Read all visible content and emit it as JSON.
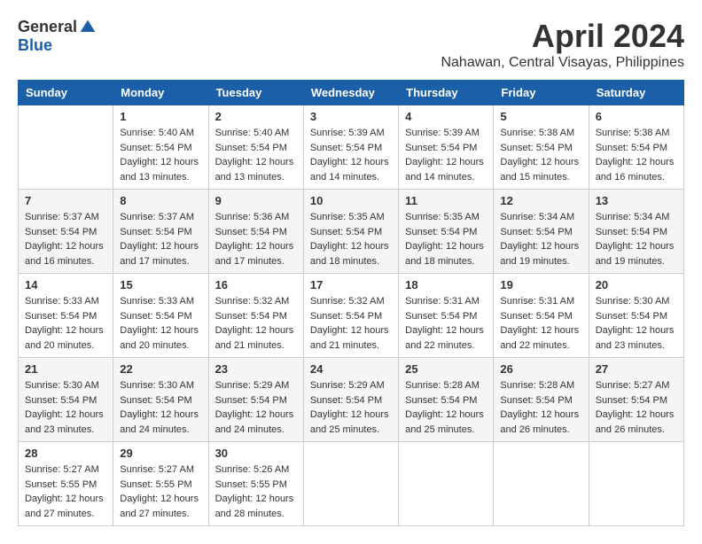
{
  "logo": {
    "general": "General",
    "blue": "Blue"
  },
  "title": {
    "month": "April 2024",
    "location": "Nahawan, Central Visayas, Philippines"
  },
  "headers": [
    "Sunday",
    "Monday",
    "Tuesday",
    "Wednesday",
    "Thursday",
    "Friday",
    "Saturday"
  ],
  "weeks": [
    [
      {
        "day": "",
        "sunrise": "",
        "sunset": "",
        "daylight": ""
      },
      {
        "day": "1",
        "sunrise": "Sunrise: 5:40 AM",
        "sunset": "Sunset: 5:54 PM",
        "daylight": "Daylight: 12 hours and 13 minutes."
      },
      {
        "day": "2",
        "sunrise": "Sunrise: 5:40 AM",
        "sunset": "Sunset: 5:54 PM",
        "daylight": "Daylight: 12 hours and 13 minutes."
      },
      {
        "day": "3",
        "sunrise": "Sunrise: 5:39 AM",
        "sunset": "Sunset: 5:54 PM",
        "daylight": "Daylight: 12 hours and 14 minutes."
      },
      {
        "day": "4",
        "sunrise": "Sunrise: 5:39 AM",
        "sunset": "Sunset: 5:54 PM",
        "daylight": "Daylight: 12 hours and 14 minutes."
      },
      {
        "day": "5",
        "sunrise": "Sunrise: 5:38 AM",
        "sunset": "Sunset: 5:54 PM",
        "daylight": "Daylight: 12 hours and 15 minutes."
      },
      {
        "day": "6",
        "sunrise": "Sunrise: 5:38 AM",
        "sunset": "Sunset: 5:54 PM",
        "daylight": "Daylight: 12 hours and 16 minutes."
      }
    ],
    [
      {
        "day": "7",
        "sunrise": "Sunrise: 5:37 AM",
        "sunset": "Sunset: 5:54 PM",
        "daylight": "Daylight: 12 hours and 16 minutes."
      },
      {
        "day": "8",
        "sunrise": "Sunrise: 5:37 AM",
        "sunset": "Sunset: 5:54 PM",
        "daylight": "Daylight: 12 hours and 17 minutes."
      },
      {
        "day": "9",
        "sunrise": "Sunrise: 5:36 AM",
        "sunset": "Sunset: 5:54 PM",
        "daylight": "Daylight: 12 hours and 17 minutes."
      },
      {
        "day": "10",
        "sunrise": "Sunrise: 5:35 AM",
        "sunset": "Sunset: 5:54 PM",
        "daylight": "Daylight: 12 hours and 18 minutes."
      },
      {
        "day": "11",
        "sunrise": "Sunrise: 5:35 AM",
        "sunset": "Sunset: 5:54 PM",
        "daylight": "Daylight: 12 hours and 18 minutes."
      },
      {
        "day": "12",
        "sunrise": "Sunrise: 5:34 AM",
        "sunset": "Sunset: 5:54 PM",
        "daylight": "Daylight: 12 hours and 19 minutes."
      },
      {
        "day": "13",
        "sunrise": "Sunrise: 5:34 AM",
        "sunset": "Sunset: 5:54 PM",
        "daylight": "Daylight: 12 hours and 19 minutes."
      }
    ],
    [
      {
        "day": "14",
        "sunrise": "Sunrise: 5:33 AM",
        "sunset": "Sunset: 5:54 PM",
        "daylight": "Daylight: 12 hours and 20 minutes."
      },
      {
        "day": "15",
        "sunrise": "Sunrise: 5:33 AM",
        "sunset": "Sunset: 5:54 PM",
        "daylight": "Daylight: 12 hours and 20 minutes."
      },
      {
        "day": "16",
        "sunrise": "Sunrise: 5:32 AM",
        "sunset": "Sunset: 5:54 PM",
        "daylight": "Daylight: 12 hours and 21 minutes."
      },
      {
        "day": "17",
        "sunrise": "Sunrise: 5:32 AM",
        "sunset": "Sunset: 5:54 PM",
        "daylight": "Daylight: 12 hours and 21 minutes."
      },
      {
        "day": "18",
        "sunrise": "Sunrise: 5:31 AM",
        "sunset": "Sunset: 5:54 PM",
        "daylight": "Daylight: 12 hours and 22 minutes."
      },
      {
        "day": "19",
        "sunrise": "Sunrise: 5:31 AM",
        "sunset": "Sunset: 5:54 PM",
        "daylight": "Daylight: 12 hours and 22 minutes."
      },
      {
        "day": "20",
        "sunrise": "Sunrise: 5:30 AM",
        "sunset": "Sunset: 5:54 PM",
        "daylight": "Daylight: 12 hours and 23 minutes."
      }
    ],
    [
      {
        "day": "21",
        "sunrise": "Sunrise: 5:30 AM",
        "sunset": "Sunset: 5:54 PM",
        "daylight": "Daylight: 12 hours and 23 minutes."
      },
      {
        "day": "22",
        "sunrise": "Sunrise: 5:30 AM",
        "sunset": "Sunset: 5:54 PM",
        "daylight": "Daylight: 12 hours and 24 minutes."
      },
      {
        "day": "23",
        "sunrise": "Sunrise: 5:29 AM",
        "sunset": "Sunset: 5:54 PM",
        "daylight": "Daylight: 12 hours and 24 minutes."
      },
      {
        "day": "24",
        "sunrise": "Sunrise: 5:29 AM",
        "sunset": "Sunset: 5:54 PM",
        "daylight": "Daylight: 12 hours and 25 minutes."
      },
      {
        "day": "25",
        "sunrise": "Sunrise: 5:28 AM",
        "sunset": "Sunset: 5:54 PM",
        "daylight": "Daylight: 12 hours and 25 minutes."
      },
      {
        "day": "26",
        "sunrise": "Sunrise: 5:28 AM",
        "sunset": "Sunset: 5:54 PM",
        "daylight": "Daylight: 12 hours and 26 minutes."
      },
      {
        "day": "27",
        "sunrise": "Sunrise: 5:27 AM",
        "sunset": "Sunset: 5:54 PM",
        "daylight": "Daylight: 12 hours and 26 minutes."
      }
    ],
    [
      {
        "day": "28",
        "sunrise": "Sunrise: 5:27 AM",
        "sunset": "Sunset: 5:55 PM",
        "daylight": "Daylight: 12 hours and 27 minutes."
      },
      {
        "day": "29",
        "sunrise": "Sunrise: 5:27 AM",
        "sunset": "Sunset: 5:55 PM",
        "daylight": "Daylight: 12 hours and 27 minutes."
      },
      {
        "day": "30",
        "sunrise": "Sunrise: 5:26 AM",
        "sunset": "Sunset: 5:55 PM",
        "daylight": "Daylight: 12 hours and 28 minutes."
      },
      {
        "day": "",
        "sunrise": "",
        "sunset": "",
        "daylight": ""
      },
      {
        "day": "",
        "sunrise": "",
        "sunset": "",
        "daylight": ""
      },
      {
        "day": "",
        "sunrise": "",
        "sunset": "",
        "daylight": ""
      },
      {
        "day": "",
        "sunrise": "",
        "sunset": "",
        "daylight": ""
      }
    ]
  ]
}
